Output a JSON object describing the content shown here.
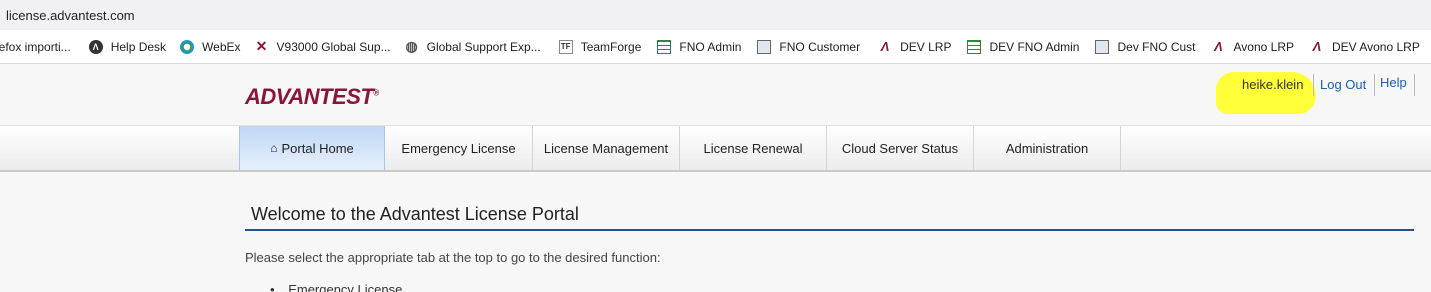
{
  "browser": {
    "url": "license.advantest.com"
  },
  "bookmarks": [
    {
      "label": "irefox importi...",
      "icon": "none"
    },
    {
      "label": "Help Desk",
      "icon": "help-desk-icon"
    },
    {
      "label": "WebEx",
      "icon": "webex-icon"
    },
    {
      "label": "V93000 Global Sup...",
      "icon": "v93000-icon"
    },
    {
      "label": "Global Support Exp...",
      "icon": "globe-icon"
    },
    {
      "label": "TeamForge",
      "icon": "teamforge-icon"
    },
    {
      "label": "FNO Admin",
      "icon": "grid-icon"
    },
    {
      "label": "FNO Customer",
      "icon": "image-icon"
    },
    {
      "label": "DEV LRP",
      "icon": "advantest-a-icon"
    },
    {
      "label": "DEV FNO Admin",
      "icon": "grid-icon"
    },
    {
      "label": "Dev FNO Cust",
      "icon": "image-icon"
    },
    {
      "label": "Avono LRP",
      "icon": "advantest-a-icon"
    },
    {
      "label": "DEV Avono LRP",
      "icon": "advantest-a-icon"
    }
  ],
  "header": {
    "logo_text": "ADVANTEST",
    "username": "heike.klein",
    "logout": "Log Out",
    "help": "Help"
  },
  "nav": {
    "tabs": [
      {
        "label": "Portal Home"
      },
      {
        "label": "Emergency License"
      },
      {
        "label": "License Management"
      },
      {
        "label": "License Renewal"
      },
      {
        "label": "Cloud Server Status"
      },
      {
        "label": "Administration"
      }
    ]
  },
  "main": {
    "title": "Welcome to the Advantest License Portal",
    "intro": "Please select the appropriate tab at the top to go to the desired function:",
    "items": [
      "Emergency License"
    ]
  }
}
